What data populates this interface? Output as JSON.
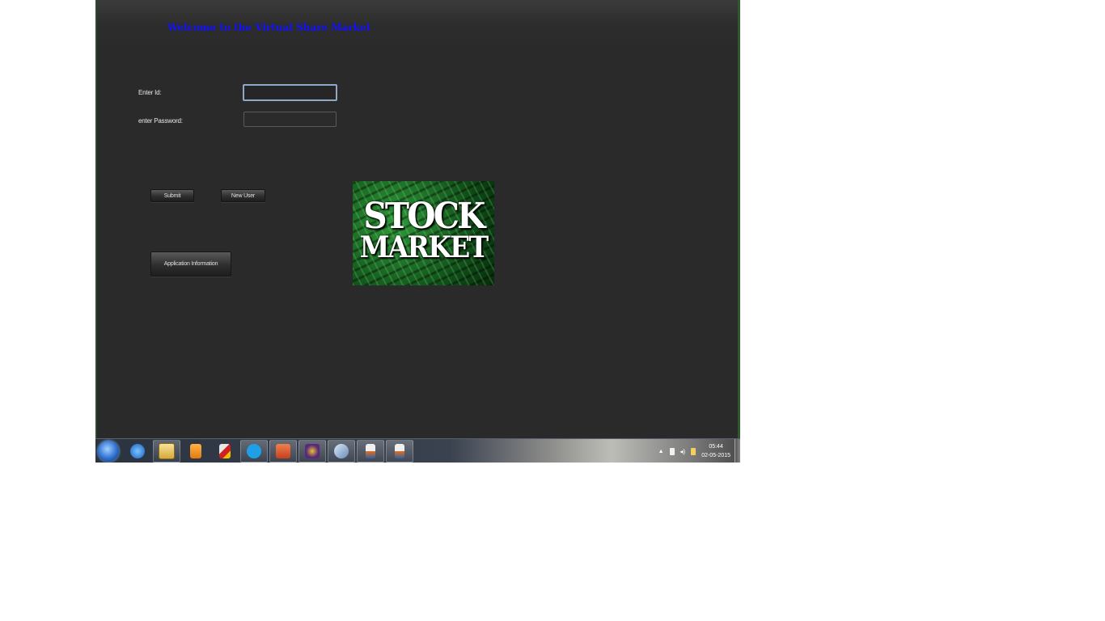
{
  "app": {
    "welcome_text": "Welcome to the Virtual Share Market",
    "id_label": "Enter Id:",
    "id_value": "",
    "password_label": "enter Password:",
    "password_value": "",
    "submit_label": "Submit",
    "new_user_label": "New User",
    "app_info_label": "Application Information",
    "banner_line1": "STOCK",
    "banner_line2": "MARKET"
  },
  "taskbar": {
    "items": [
      {
        "icon": "internet-explorer-icon"
      },
      {
        "icon": "file-explorer-icon"
      },
      {
        "icon": "media-player-icon"
      },
      {
        "icon": "microsoft-office-icon"
      },
      {
        "icon": "skype-icon"
      },
      {
        "icon": "powerpoint-icon"
      },
      {
        "icon": "dvd-maker-icon"
      },
      {
        "icon": "pen-tablet-icon"
      },
      {
        "icon": "java-icon"
      },
      {
        "icon": "java-icon"
      }
    ],
    "tray_icons": [
      "show-hidden-icons-icon",
      "power-icon",
      "volume-icon",
      "action-center-icon"
    ],
    "time": "05:44",
    "date": "02-05-2015"
  },
  "colors": {
    "window_bg": "#2a2a2a",
    "welcome_text": "#1010ff",
    "banner_green": "#1f7a2a"
  }
}
